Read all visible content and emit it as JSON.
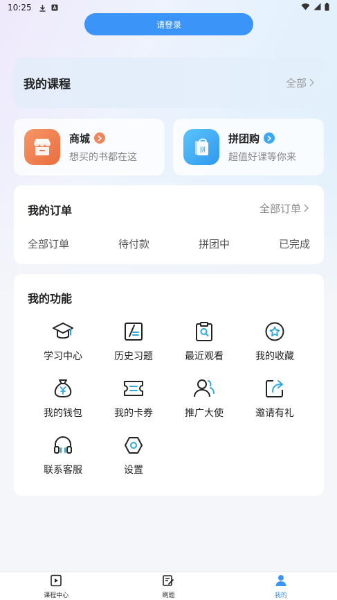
{
  "status_bar": {
    "time": "10:25"
  },
  "login_button": "请登录",
  "courses": {
    "title": "我的课程",
    "more": "全部"
  },
  "promos": [
    {
      "title": "商城",
      "subtitle": "想买的书都在这",
      "color": "#f0855a"
    },
    {
      "title": "拼团购",
      "subtitle": "超值好课等你来",
      "color": "#3ca7f2"
    }
  ],
  "orders": {
    "title": "我的订单",
    "more": "全部订单",
    "tabs": [
      "全部订单",
      "待付款",
      "拼团中",
      "已完成"
    ]
  },
  "functions": {
    "title": "我的功能",
    "items": [
      {
        "label": "学习中心",
        "icon": "graduation-cap-icon"
      },
      {
        "label": "历史习题",
        "icon": "exercise-history-icon"
      },
      {
        "label": "最近观看",
        "icon": "clipboard-search-icon"
      },
      {
        "label": "我的收藏",
        "icon": "star-icon"
      },
      {
        "label": "我的钱包",
        "icon": "money-bag-icon"
      },
      {
        "label": "我的卡券",
        "icon": "ticket-icon"
      },
      {
        "label": "推广大使",
        "icon": "ambassador-icon"
      },
      {
        "label": "邀请有礼",
        "icon": "share-icon"
      },
      {
        "label": "联系客服",
        "icon": "headset-icon"
      },
      {
        "label": "设置",
        "icon": "settings-icon"
      }
    ]
  },
  "tabbar": [
    {
      "label": "课程中心",
      "icon": "course-video-icon",
      "active": false
    },
    {
      "label": "刷题",
      "icon": "practice-edit-icon",
      "active": false
    },
    {
      "label": "我的",
      "icon": "profile-icon",
      "active": true
    }
  ],
  "colors": {
    "accent": "#3b95f8",
    "icon_blue": "#2ea7e0",
    "text_dark": "#222222"
  }
}
